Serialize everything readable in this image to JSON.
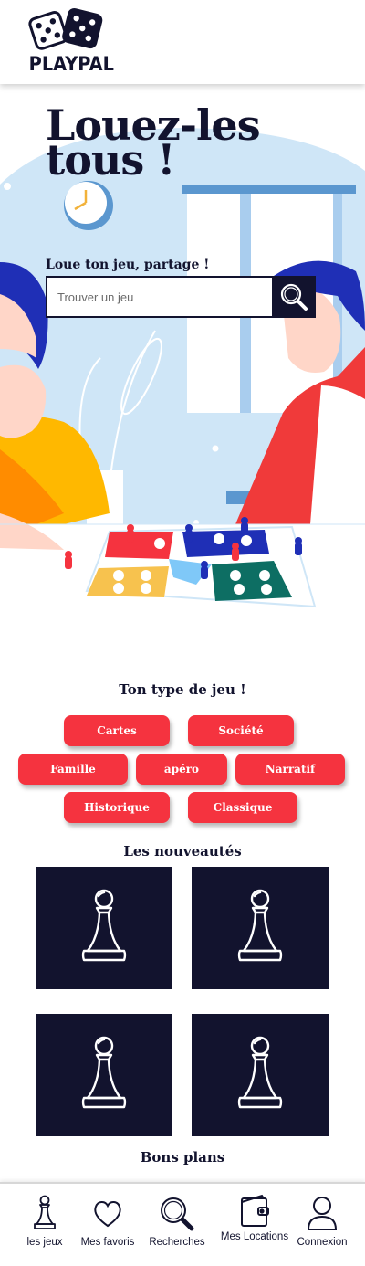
{
  "brand": {
    "name": "PLAYPAL"
  },
  "hero": {
    "title": "Louez-les tous !",
    "subtitle": "Loue ton jeu, partage !",
    "search_placeholder": "Trouver un jeu"
  },
  "categories": {
    "title": "Ton type de jeu !",
    "items": [
      "Cartes",
      "Société",
      "Famille",
      "apéro",
      "Narratif",
      "Historique",
      "Classique"
    ]
  },
  "new_items": {
    "title": "Les nouveautés",
    "count_shown": 4
  },
  "deals": {
    "title": "Bons plans"
  },
  "bottom_nav": {
    "items": [
      {
        "label": "les jeux",
        "icon": "pawn-icon"
      },
      {
        "label": "Mes favoris",
        "icon": "heart-icon"
      },
      {
        "label": "Recherches",
        "icon": "search-icon"
      },
      {
        "label": "Mes Locations",
        "icon": "wallet-icon"
      },
      {
        "label": "Connexion",
        "icon": "user-icon"
      }
    ]
  },
  "colors": {
    "navy": "#12132e",
    "accent_red": "#f5333f",
    "sky_blue": "#cfe6f7"
  }
}
